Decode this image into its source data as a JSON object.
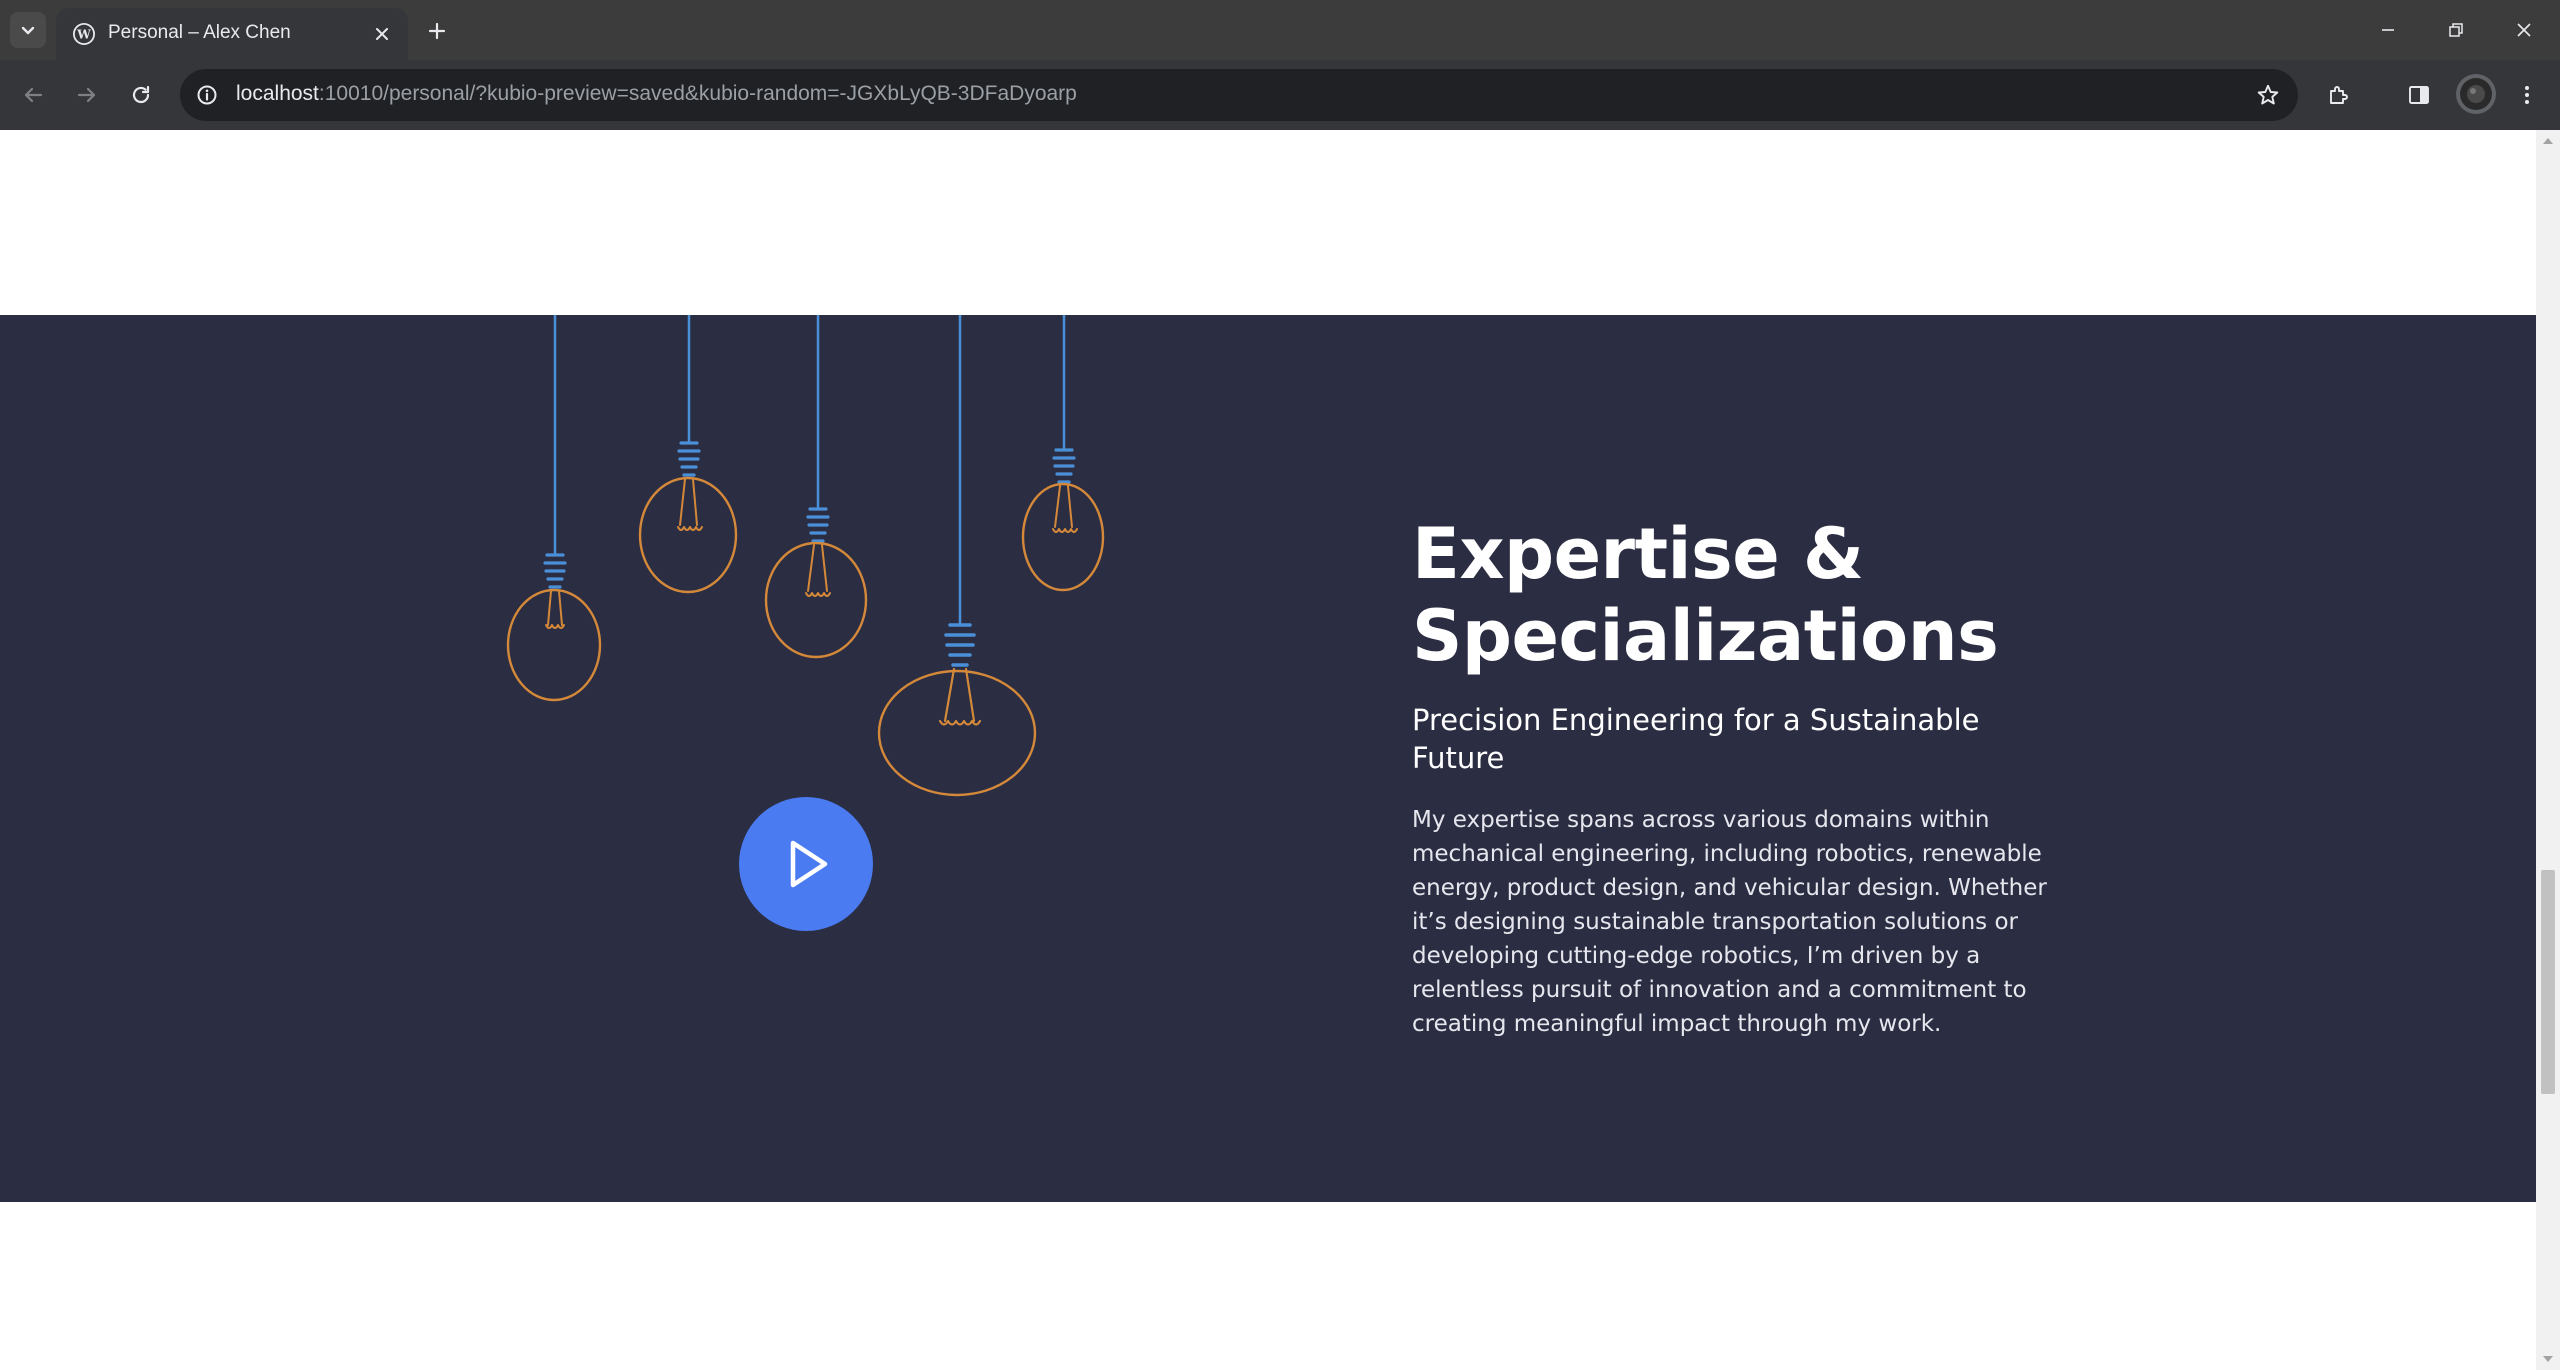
{
  "browser": {
    "tab_title": "Personal – Alex Chen",
    "url_host": "localhost",
    "url_rest": ":10010/personal/?kubio-preview=saved&kubio-random=-JGXbLyQB-3DFaDyoarp"
  },
  "section": {
    "heading_line1": "Expertise &",
    "heading_line2": "Specializations",
    "subheading": "Precision Engineering for a Sustainable Future",
    "body": "My expertise spans across various domains within mechanical engineering, including robotics, renewable energy, product design, and vehicular design. Whether it’s designing sustainable transportation solutions or developing cutting-edge robotics, I’m driven by a relentless pursuit of innovation and a commitment to creating meaningful impact through my work."
  },
  "colors": {
    "section_bg": "#2b2d42",
    "play_button": "#4a7bf0",
    "bulb_wire": "#4a90d9",
    "bulb_glass": "#d4893a"
  },
  "icons": [
    "tab-search-icon",
    "wordpress-icon",
    "close-icon",
    "plus-icon",
    "minimize-icon",
    "restore-icon",
    "close-window-icon",
    "back-arrow-icon",
    "forward-arrow-icon",
    "reload-icon",
    "info-icon",
    "star-icon",
    "extensions-icon",
    "side-panel-icon",
    "menu-dots-icon",
    "play-icon"
  ]
}
